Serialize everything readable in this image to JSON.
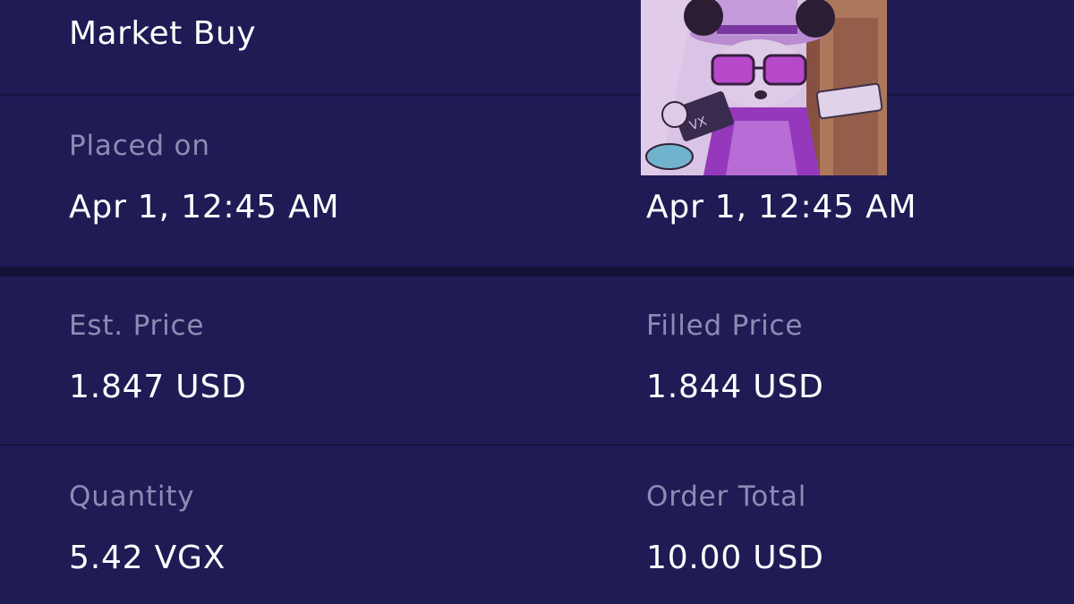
{
  "order": {
    "title": "Market Buy"
  },
  "placed": {
    "label": "Placed on",
    "value": "Apr 1, 12:45 AM"
  },
  "completed": {
    "value": "Apr 1, 12:45 AM"
  },
  "est_price": {
    "label": "Est. Price",
    "value": "1.847 USD"
  },
  "filled_price": {
    "label": "Filled Price",
    "value": "1.844 USD"
  },
  "quantity": {
    "label": "Quantity",
    "value": "5.42 VGX"
  },
  "order_total": {
    "label": "Order Total",
    "value": "10.00 USD"
  },
  "overlay": {
    "icon": "cartoon-mouse-artwork"
  }
}
